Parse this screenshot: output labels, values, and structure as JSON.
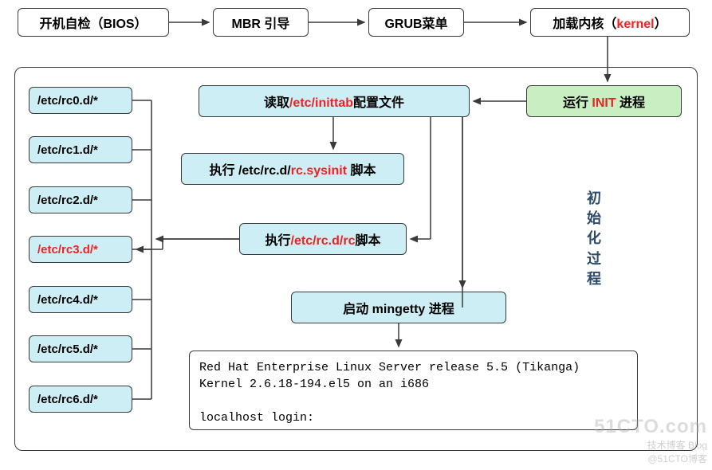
{
  "top_row": {
    "bios": "开机自检（BIOS）",
    "mbr": "MBR 引导",
    "grub": "GRUB菜单",
    "kernel_pre": "加载内核（",
    "kernel_red": "kernel",
    "kernel_post": "）"
  },
  "init": {
    "pre": "运行 ",
    "red": "INIT",
    "post": " 进程"
  },
  "inittab": {
    "pre": "读取",
    "red": "/etc/inittab",
    "post": "配置文件"
  },
  "sysinit": {
    "pre": "执行 /etc/rc.d/",
    "red": "rc.sysinit",
    "post": " 脚本"
  },
  "rc_script": {
    "pre": "执行",
    "red": "/etc/rc.d/rc",
    "post": "脚本"
  },
  "mingetty": "启动 mingetty 进程",
  "rc_dirs": [
    "/etc/rc0.d/*",
    "/etc/rc1.d/*",
    "/etc/rc2.d/*",
    "/etc/rc3.d/*",
    "/etc/rc4.d/*",
    "/etc/rc5.d/*",
    "/etc/rc6.d/*"
  ],
  "side_label": [
    "初",
    "始",
    "化",
    "过",
    "程"
  ],
  "terminal": {
    "l1": "Red Hat Enterprise Linux Server release 5.5 (Tikanga)",
    "l2": "Kernel 2.6.18-194.el5 on an i686",
    "l3": "localhost login:"
  },
  "watermark": {
    "big": "51CTO.com",
    "sub1": "技术博客 Blog",
    "sub2": "@51CTO博客"
  }
}
